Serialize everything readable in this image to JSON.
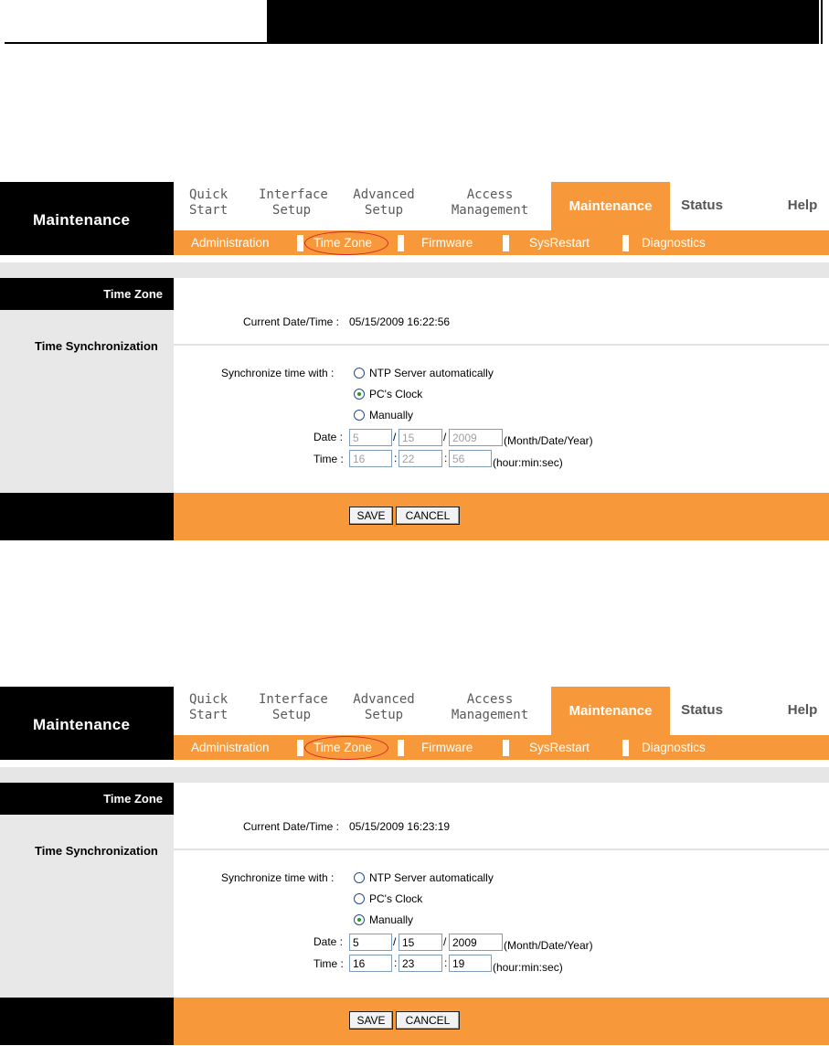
{
  "panels": [
    {
      "brand": "Maintenance",
      "menu": [
        {
          "l1": "Quick",
          "l2": "Start"
        },
        {
          "l1": "Interface",
          "l2": "Setup"
        },
        {
          "l1": "Advanced",
          "l2": "Setup"
        },
        {
          "l1": "Access",
          "l2": "Management"
        },
        {
          "label": "Maintenance"
        },
        {
          "label": "Status"
        },
        {
          "label": "Help"
        }
      ],
      "subnav": [
        "Administration",
        "Time Zone",
        "Firmware",
        "SysRestart",
        "Diagnostics"
      ],
      "section_title": "Time Zone",
      "section_label": "Time Synchronization",
      "current_label": "Current Date/Time :",
      "current_value": "05/15/2009 16:22:56",
      "sync_label": "Synchronize time with :",
      "radio_ntp": "NTP Server automatically",
      "radio_pc": "PC's Clock",
      "radio_manual": "Manually",
      "selected": "pc",
      "date_label": "Date :",
      "date_month": "5",
      "date_day": "15",
      "date_year": "2009",
      "date_hint": "(Month/Date/Year)",
      "time_label": "Time :",
      "time_hour": "16",
      "time_min": "22",
      "time_sec": "56",
      "time_hint": "(hour:min:sec)",
      "save_label": "SAVE",
      "cancel_label": "CANCEL"
    },
    {
      "brand": "Maintenance",
      "menu": [
        {
          "l1": "Quick",
          "l2": "Start"
        },
        {
          "l1": "Interface",
          "l2": "Setup"
        },
        {
          "l1": "Advanced",
          "l2": "Setup"
        },
        {
          "l1": "Access",
          "l2": "Management"
        },
        {
          "label": "Maintenance"
        },
        {
          "label": "Status"
        },
        {
          "label": "Help"
        }
      ],
      "subnav": [
        "Administration",
        "Time Zone",
        "Firmware",
        "SysRestart",
        "Diagnostics"
      ],
      "section_title": "Time Zone",
      "section_label": "Time Synchronization",
      "current_label": "Current Date/Time :",
      "current_value": "05/15/2009 16:23:19",
      "sync_label": "Synchronize time with :",
      "radio_ntp": "NTP Server automatically",
      "radio_pc": "PC's Clock",
      "radio_manual": "Manually",
      "selected": "manual",
      "date_label": "Date :",
      "date_month": "5",
      "date_day": "15",
      "date_year": "2009",
      "date_hint": "(Month/Date/Year)",
      "time_label": "Time :",
      "time_hour": "16",
      "time_min": "23",
      "time_sec": "19",
      "time_hint": "(hour:min:sec)",
      "save_label": "SAVE",
      "cancel_label": "CANCEL"
    }
  ]
}
